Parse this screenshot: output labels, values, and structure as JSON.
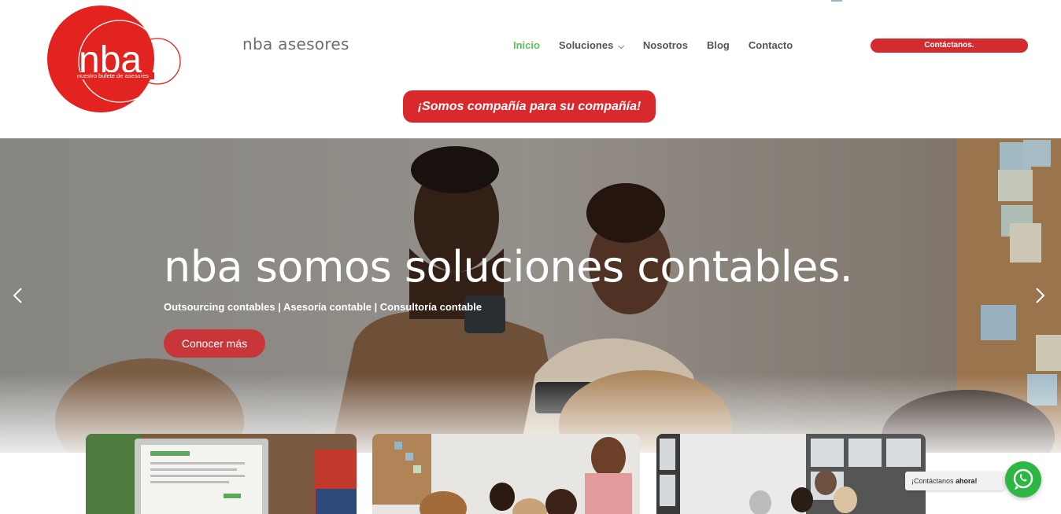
{
  "header": {
    "logo_text": "nba",
    "logo_tagline": "nuestro bufete de asesores",
    "brand_name": "nba asesores",
    "nav": [
      {
        "label": "Inicio",
        "active": true
      },
      {
        "label": "Soluciones",
        "has_dropdown": true
      },
      {
        "label": "Nosotros"
      },
      {
        "label": "Blog"
      },
      {
        "label": "Contacto"
      }
    ],
    "cta_label": "Contáctanos.",
    "slogan": "¡Somos compañía para su compañía!"
  },
  "hero": {
    "title": "nba somos soluciones contables.",
    "subtitle": "Outsourcing contables | Asesoría contable | Consultoría contable",
    "button_label": "Conocer más",
    "prev_icon": "chevron-left-icon",
    "next_icon": "chevron-right-icon"
  },
  "whatsapp": {
    "label_prefix": "¡Contáctanos ",
    "label_bold": "ahora!",
    "icon": "whatsapp-icon"
  },
  "colors": {
    "brand_red": "#d82a2d",
    "active_nav": "#5cc25c",
    "whatsapp_green": "#2db742"
  }
}
